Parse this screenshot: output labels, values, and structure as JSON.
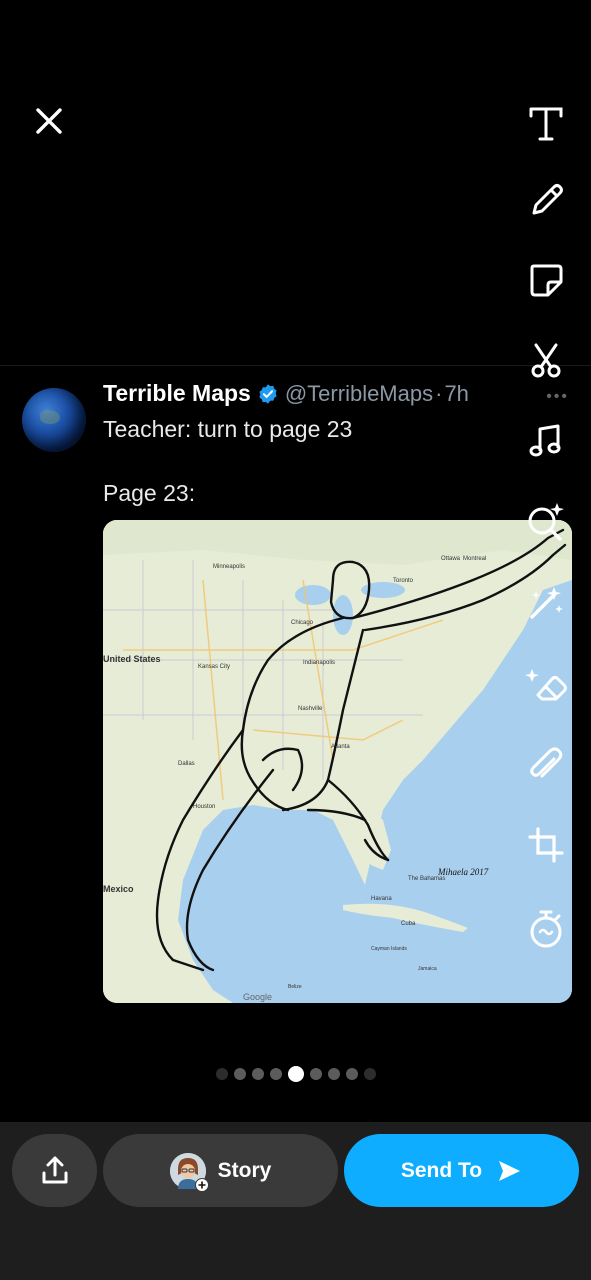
{
  "tweet": {
    "author": "Terrible Maps",
    "handle": "@TerribleMaps",
    "separator": "·",
    "time": "7h",
    "line1": "Teacher: turn to page 23",
    "line2": "Page 23:"
  },
  "map": {
    "labels": [
      "United States",
      "Mexico",
      "Cuba",
      "Kansas City",
      "Chicago",
      "Indianapolis",
      "Nashville",
      "Atlanta",
      "Houston",
      "Dallas",
      "Toronto",
      "Ottawa",
      "Montreal",
      "Minneapolis",
      "Havana",
      "The Bahamas",
      "Cayman Islands",
      "Jamaica",
      "Belize",
      "Google"
    ],
    "signature": "Mihaela 2017"
  },
  "toolbar": {
    "tools": [
      "text-tool",
      "pen-tool",
      "sticker-tool",
      "scissors-tool",
      "music-tool",
      "lens-tool",
      "magic-wand-tool",
      "eraser-tool",
      "attach-link-tool",
      "crop-tool",
      "timer-tool"
    ]
  },
  "pager": {
    "total": 9,
    "active_index": 4
  },
  "bottom_bar": {
    "story_label": "Story",
    "send_label": "Send To",
    "send_color": "#0fadff"
  }
}
